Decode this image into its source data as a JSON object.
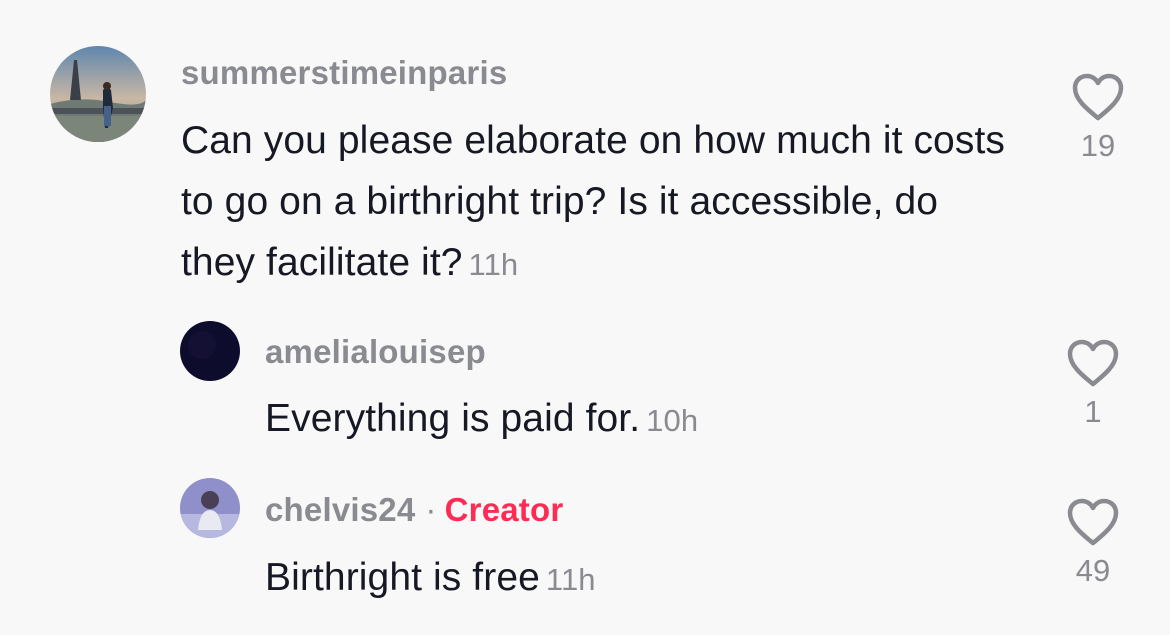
{
  "comments": [
    {
      "username": "summerstimeinparis",
      "text": "Can you please elaborate on how much it costs to go on a birthright trip? Is it accessible, do they facilitate it?",
      "time": "11h",
      "likes": "19",
      "avatar": "eiffel-tower-photo"
    },
    {
      "username": "amelialouisep",
      "text": "Everything is paid for.",
      "time": "10h",
      "likes": "1",
      "avatar": "dark-photo"
    },
    {
      "username": "chelvis24",
      "separator": "·",
      "badge": "Creator",
      "text": "Birthright is free",
      "time": "11h",
      "likes": "49",
      "avatar": "person-photo"
    }
  ],
  "colors": {
    "background": "#f8f8f8",
    "username": "#8a8b91",
    "text": "#161823",
    "creator_badge": "#fe2c55",
    "heart_outline": "#8a8b91"
  }
}
